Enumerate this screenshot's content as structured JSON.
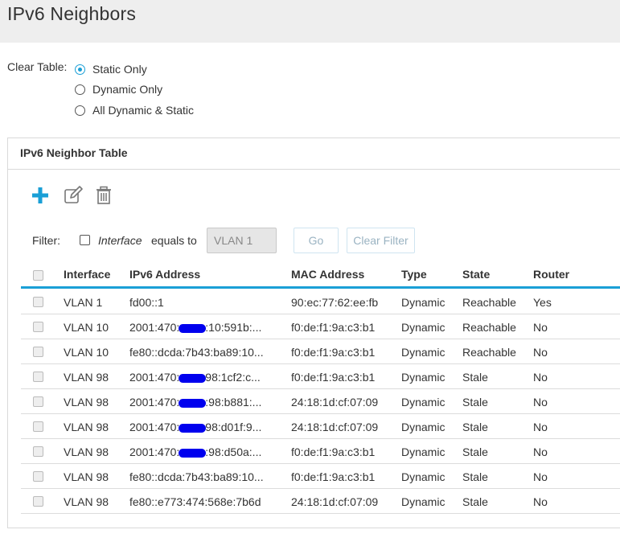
{
  "page": {
    "title": "IPv6 Neighbors"
  },
  "clear_table": {
    "label": "Clear Table:",
    "options": [
      {
        "label": "Static Only",
        "selected": true
      },
      {
        "label": "Dynamic Only",
        "selected": false
      },
      {
        "label": "All Dynamic & Static",
        "selected": false
      }
    ]
  },
  "panel": {
    "title": "IPv6 Neighbor Table"
  },
  "toolbar": {
    "icons": [
      "add-icon",
      "edit-icon",
      "delete-icon"
    ]
  },
  "filter": {
    "label": "Filter:",
    "field": "Interface",
    "operator": "equals to",
    "value": "VLAN 1",
    "go_label": "Go",
    "clear_label": "Clear Filter"
  },
  "table": {
    "columns": [
      "Interface",
      "IPv6 Address",
      "MAC Address",
      "Type",
      "State",
      "Router"
    ],
    "rows": [
      {
        "interface": "VLAN 1",
        "ip_pre": "fd00::1",
        "redacted": false,
        "ip_post": "",
        "mac": "90:ec:77:62:ee:fb",
        "type": "Dynamic",
        "state": "Reachable",
        "router": "Yes"
      },
      {
        "interface": "VLAN 10",
        "ip_pre": "2001:470:",
        "redacted": true,
        "ip_post": ":10:591b:...",
        "mac": "f0:de:f1:9a:c3:b1",
        "type": "Dynamic",
        "state": "Reachable",
        "router": "No"
      },
      {
        "interface": "VLAN 10",
        "ip_pre": "fe80::dcda:7b43:ba89:10...",
        "redacted": false,
        "ip_post": "",
        "mac": "f0:de:f1:9a:c3:b1",
        "type": "Dynamic",
        "state": "Reachable",
        "router": "No"
      },
      {
        "interface": "VLAN 98",
        "ip_pre": "2001:470:",
        "redacted": true,
        "ip_post": "98:1cf2:c...",
        "mac": "f0:de:f1:9a:c3:b1",
        "type": "Dynamic",
        "state": "Stale",
        "router": "No"
      },
      {
        "interface": "VLAN 98",
        "ip_pre": "2001:470:",
        "redacted": true,
        "ip_post": ":98:b881:...",
        "mac": "24:18:1d:cf:07:09",
        "type": "Dynamic",
        "state": "Stale",
        "router": "No"
      },
      {
        "interface": "VLAN 98",
        "ip_pre": "2001:470:",
        "redacted": true,
        "ip_post": "98:d01f:9...",
        "mac": "24:18:1d:cf:07:09",
        "type": "Dynamic",
        "state": "Stale",
        "router": "No"
      },
      {
        "interface": "VLAN 98",
        "ip_pre": "2001:470:",
        "redacted": true,
        "ip_post": ":98:d50a:...",
        "mac": "f0:de:f1:9a:c3:b1",
        "type": "Dynamic",
        "state": "Stale",
        "router": "No"
      },
      {
        "interface": "VLAN 98",
        "ip_pre": "fe80::dcda:7b43:ba89:10...",
        "redacted": false,
        "ip_post": "",
        "mac": "f0:de:f1:9a:c3:b1",
        "type": "Dynamic",
        "state": "Stale",
        "router": "No"
      },
      {
        "interface": "VLAN 98",
        "ip_pre": "fe80::e773:474:568e:7b6d",
        "redacted": false,
        "ip_post": "",
        "mac": "24:18:1d:cf:07:09",
        "type": "Dynamic",
        "state": "Stale",
        "router": "No"
      }
    ]
  },
  "colors": {
    "accent": "#1a9fd6",
    "redaction": "#0000ee",
    "header_bg": "#eeeeee"
  }
}
